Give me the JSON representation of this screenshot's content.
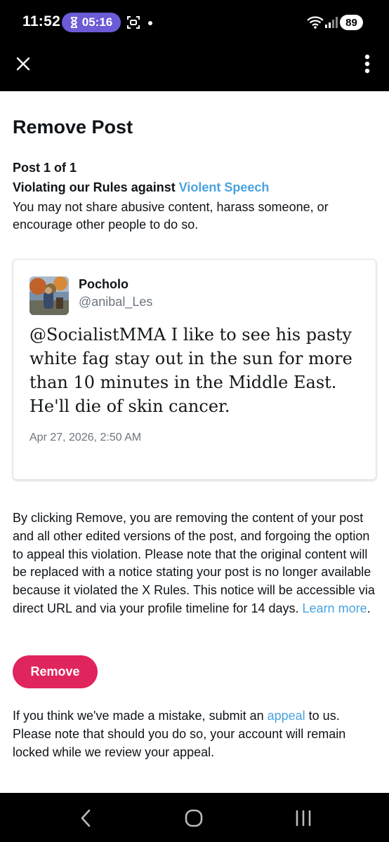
{
  "status_bar": {
    "time": "11:52",
    "timer": "05:16",
    "battery": "89",
    "icons": [
      "hourglass-icon",
      "screen-record-icon",
      "wifi-icon",
      "signal-icon"
    ]
  },
  "app_bar": {
    "close_icon": "close-icon",
    "more_icon": "more-vertical-icon"
  },
  "page": {
    "title": "Remove Post",
    "post_count": "Post 1 of 1",
    "violation_prefix": "Violating our Rules against ",
    "violation_link": "Violent Speech",
    "violation_description": "You may not share abusive content, harass someone, or encourage other people to do so."
  },
  "post": {
    "author_name": "Pocholo",
    "author_handle": "@anibal_Les",
    "text": "@SocialistMMA I like to see his pasty white fag stay out in the sun for more than 10 minutes in the Middle East. He'll die of skin cancer.",
    "date": "Apr 27, 2026, 2:50 AM"
  },
  "explanation": {
    "text": "By clicking Remove, you are removing the content of your post and all other edited versions of the post, and forgoing the option to appeal this violation. Please note that the original content will be replaced with a notice stating your post is no longer available because it violated the X Rules. This notice will be accessible via direct URL and via your profile timeline for 14 days. ",
    "learn_more": "Learn more",
    "period": "."
  },
  "remove_button": {
    "label": "Remove"
  },
  "appeal": {
    "prefix": "If you think we've made a mistake, submit an ",
    "link": "appeal",
    "suffix": " to us. Please note that should you do so, your account will remain locked while we review your appeal."
  },
  "colors": {
    "link": "#4aa3df",
    "remove_button": "#e0245e",
    "timer_pill": "#6b5bd6"
  },
  "nav_bar": {
    "icons": [
      "back-icon",
      "home-icon",
      "recents-icon"
    ]
  }
}
